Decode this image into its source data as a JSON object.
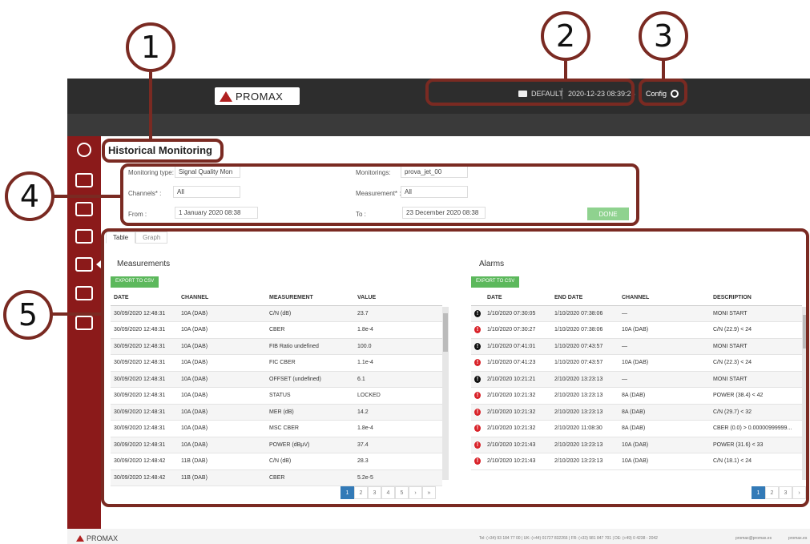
{
  "callouts": [
    "1",
    "2",
    "3",
    "4",
    "5"
  ],
  "header": {
    "logo_text": "PROMAX",
    "profile": "DEFAULT",
    "datetime": "2020-12-23 08:39:25",
    "config_label": "Config"
  },
  "page": {
    "title": "Historical Monitoring"
  },
  "form": {
    "monitoring_type_label": "Monitoring type:",
    "monitoring_type_value": "Signal Quality Mon",
    "monitorings_label": "Monitorings:",
    "monitorings_value": "prova_jet_00",
    "channels_label": "Channels* :",
    "channels_value": "All",
    "measurement_label": "Measurement* :",
    "measurement_value": "All",
    "from_label": "From :",
    "from_value": "1 January 2020 08:38",
    "to_label": "To :",
    "to_value": "23 December 2020 08:38",
    "done_label": "DONE"
  },
  "tabs": [
    "Table",
    "Graph"
  ],
  "measurements": {
    "title": "Measurements",
    "export_label": "EXPORT TO CSV",
    "headers": [
      "DATE",
      "CHANNEL",
      "MEASUREMENT",
      "VALUE"
    ],
    "rows": [
      [
        "30/09/2020 12:48:31",
        "10A (DAB)",
        "C/N (dB)",
        "23.7"
      ],
      [
        "30/09/2020 12:48:31",
        "10A (DAB)",
        "CBER",
        "1.8e-4"
      ],
      [
        "30/09/2020 12:48:31",
        "10A (DAB)",
        "FIB Ratio undefined",
        "100.0"
      ],
      [
        "30/09/2020 12:48:31",
        "10A (DAB)",
        "FIC CBER",
        "1.1e-4"
      ],
      [
        "30/09/2020 12:48:31",
        "10A (DAB)",
        "OFFSET (undefined)",
        "6.1"
      ],
      [
        "30/09/2020 12:48:31",
        "10A (DAB)",
        "STATUS",
        "LOCKED"
      ],
      [
        "30/09/2020 12:48:31",
        "10A (DAB)",
        "MER (dB)",
        "14.2"
      ],
      [
        "30/09/2020 12:48:31",
        "10A (DAB)",
        "MSC CBER",
        "1.8e-4"
      ],
      [
        "30/09/2020 12:48:31",
        "10A (DAB)",
        "POWER (dBμV)",
        "37.4"
      ],
      [
        "30/09/2020 12:48:42",
        "11B (DAB)",
        "C/N (dB)",
        "28.3"
      ],
      [
        "30/09/2020 12:48:42",
        "11B (DAB)",
        "CBER",
        "5.2e-5"
      ]
    ],
    "pages": [
      "1",
      "2",
      "3",
      "4",
      "5",
      "›",
      "»"
    ]
  },
  "alarms": {
    "title": "Alarms",
    "export_label": "EXPORT TO CSV",
    "headers": [
      "DATE",
      "END DATE",
      "CHANNEL",
      "DESCRIPTION"
    ],
    "rows": [
      {
        "level": "info",
        "cells": [
          "1/10/2020 07:30:05",
          "1/10/2020 07:38:06",
          "—",
          "MONI START"
        ]
      },
      {
        "level": "alarm",
        "cells": [
          "1/10/2020 07:30:27",
          "1/10/2020 07:38:06",
          "10A (DAB)",
          "C/N (22.9) < 24"
        ]
      },
      {
        "level": "info",
        "cells": [
          "1/10/2020 07:41:01",
          "1/10/2020 07:43:57",
          "—",
          "MONI START"
        ]
      },
      {
        "level": "alarm",
        "cells": [
          "1/10/2020 07:41:23",
          "1/10/2020 07:43:57",
          "10A (DAB)",
          "C/N (22.3) < 24"
        ]
      },
      {
        "level": "info",
        "cells": [
          "2/10/2020 10:21:21",
          "2/10/2020 13:23:13",
          "—",
          "MONI START"
        ]
      },
      {
        "level": "alarm",
        "cells": [
          "2/10/2020 10:21:32",
          "2/10/2020 13:23:13",
          "8A (DAB)",
          "POWER (38.4) < 42"
        ]
      },
      {
        "level": "alarm",
        "cells": [
          "2/10/2020 10:21:32",
          "2/10/2020 13:23:13",
          "8A (DAB)",
          "C/N (29.7) < 32"
        ]
      },
      {
        "level": "alarm",
        "cells": [
          "2/10/2020 10:21:32",
          "2/10/2020 11:08:30",
          "8A (DAB)",
          "CBER (0.0) > 0.00000999999..."
        ]
      },
      {
        "level": "alarm",
        "cells": [
          "2/10/2020 10:21:43",
          "2/10/2020 13:23:13",
          "10A (DAB)",
          "POWER (31.6) < 33"
        ]
      },
      {
        "level": "alarm",
        "cells": [
          "2/10/2020 10:21:43",
          "2/10/2020 13:23:13",
          "10A (DAB)",
          "C/N (18.1) < 24"
        ]
      }
    ],
    "pages": [
      "1",
      "2",
      "3",
      "›"
    ]
  },
  "footer": {
    "logo_text": "PROMAX",
    "contacts": "Tel: (+34) 93 184 77 00 | UK: (+44) 01727 832266 | FR: (+33) 981 847 701 | DE: (+49) 0 4238 - 2042",
    "email": "promax@promax.es",
    "web": "promax.es"
  },
  "colors": {
    "accent": "#8b1a1a",
    "callout": "#7a2a22",
    "green": "#5cb85c",
    "pager_active": "#337ab7"
  }
}
